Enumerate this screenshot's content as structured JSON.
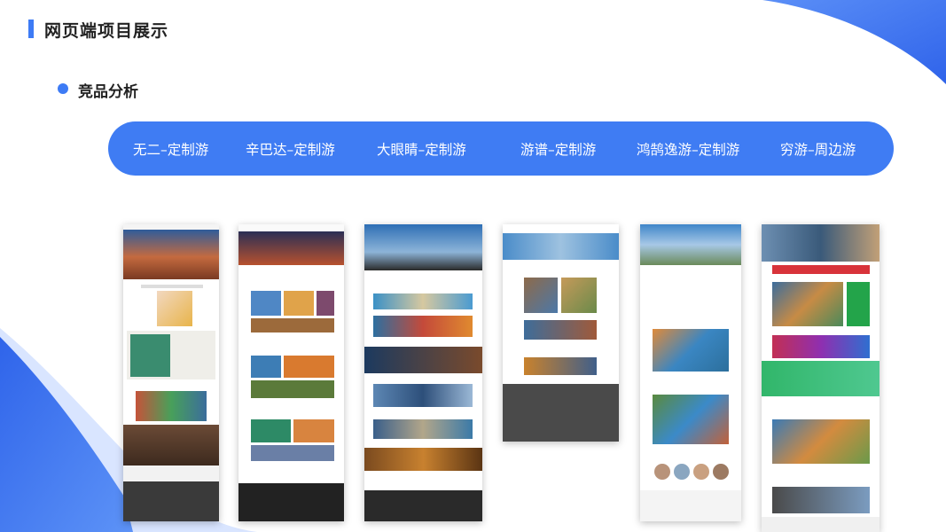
{
  "page": {
    "title": "网页端项目展示",
    "section": "竞品分析"
  },
  "competitors": [
    {
      "label": "无二–定制游"
    },
    {
      "label": "辛巴达–定制游"
    },
    {
      "label": "大眼睛–定制游"
    },
    {
      "label": "游谱–定制游"
    },
    {
      "label": "鸿鹄逸游–定制游"
    },
    {
      "label": "穷游–周边游"
    }
  ],
  "colors": {
    "accent": "#3d7bf5",
    "pill": "#3f7cf3",
    "wave": "#3a6ef0"
  },
  "screenshots_images": [
    {
      "icon": "website-screenshot-wuer"
    },
    {
      "icon": "website-screenshot-xinbada"
    },
    {
      "icon": "website-screenshot-dayanjing"
    },
    {
      "icon": "website-screenshot-youpu"
    },
    {
      "icon": "website-screenshot-honghuyiyou"
    },
    {
      "icon": "website-screenshot-qiongyou"
    }
  ]
}
